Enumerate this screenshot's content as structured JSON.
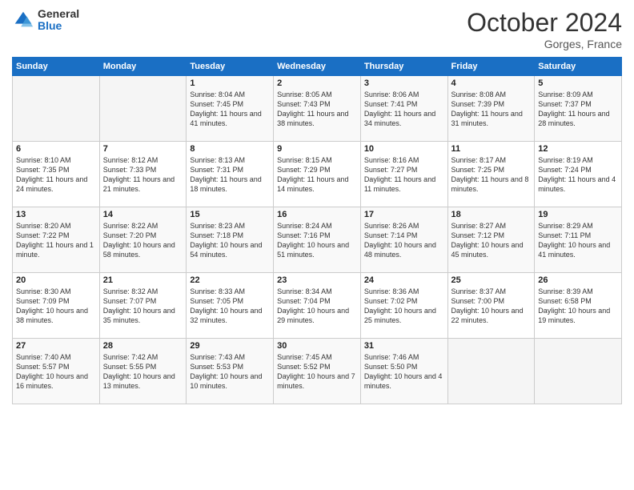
{
  "header": {
    "logo_general": "General",
    "logo_blue": "Blue",
    "month_title": "October 2024",
    "subtitle": "Gorges, France"
  },
  "days_of_week": [
    "Sunday",
    "Monday",
    "Tuesday",
    "Wednesday",
    "Thursday",
    "Friday",
    "Saturday"
  ],
  "weeks": [
    [
      {
        "day": "",
        "info": ""
      },
      {
        "day": "",
        "info": ""
      },
      {
        "day": "1",
        "info": "Sunrise: 8:04 AM\nSunset: 7:45 PM\nDaylight: 11 hours and 41 minutes."
      },
      {
        "day": "2",
        "info": "Sunrise: 8:05 AM\nSunset: 7:43 PM\nDaylight: 11 hours and 38 minutes."
      },
      {
        "day": "3",
        "info": "Sunrise: 8:06 AM\nSunset: 7:41 PM\nDaylight: 11 hours and 34 minutes."
      },
      {
        "day": "4",
        "info": "Sunrise: 8:08 AM\nSunset: 7:39 PM\nDaylight: 11 hours and 31 minutes."
      },
      {
        "day": "5",
        "info": "Sunrise: 8:09 AM\nSunset: 7:37 PM\nDaylight: 11 hours and 28 minutes."
      }
    ],
    [
      {
        "day": "6",
        "info": "Sunrise: 8:10 AM\nSunset: 7:35 PM\nDaylight: 11 hours and 24 minutes."
      },
      {
        "day": "7",
        "info": "Sunrise: 8:12 AM\nSunset: 7:33 PM\nDaylight: 11 hours and 21 minutes."
      },
      {
        "day": "8",
        "info": "Sunrise: 8:13 AM\nSunset: 7:31 PM\nDaylight: 11 hours and 18 minutes."
      },
      {
        "day": "9",
        "info": "Sunrise: 8:15 AM\nSunset: 7:29 PM\nDaylight: 11 hours and 14 minutes."
      },
      {
        "day": "10",
        "info": "Sunrise: 8:16 AM\nSunset: 7:27 PM\nDaylight: 11 hours and 11 minutes."
      },
      {
        "day": "11",
        "info": "Sunrise: 8:17 AM\nSunset: 7:25 PM\nDaylight: 11 hours and 8 minutes."
      },
      {
        "day": "12",
        "info": "Sunrise: 8:19 AM\nSunset: 7:24 PM\nDaylight: 11 hours and 4 minutes."
      }
    ],
    [
      {
        "day": "13",
        "info": "Sunrise: 8:20 AM\nSunset: 7:22 PM\nDaylight: 11 hours and 1 minute."
      },
      {
        "day": "14",
        "info": "Sunrise: 8:22 AM\nSunset: 7:20 PM\nDaylight: 10 hours and 58 minutes."
      },
      {
        "day": "15",
        "info": "Sunrise: 8:23 AM\nSunset: 7:18 PM\nDaylight: 10 hours and 54 minutes."
      },
      {
        "day": "16",
        "info": "Sunrise: 8:24 AM\nSunset: 7:16 PM\nDaylight: 10 hours and 51 minutes."
      },
      {
        "day": "17",
        "info": "Sunrise: 8:26 AM\nSunset: 7:14 PM\nDaylight: 10 hours and 48 minutes."
      },
      {
        "day": "18",
        "info": "Sunrise: 8:27 AM\nSunset: 7:12 PM\nDaylight: 10 hours and 45 minutes."
      },
      {
        "day": "19",
        "info": "Sunrise: 8:29 AM\nSunset: 7:11 PM\nDaylight: 10 hours and 41 minutes."
      }
    ],
    [
      {
        "day": "20",
        "info": "Sunrise: 8:30 AM\nSunset: 7:09 PM\nDaylight: 10 hours and 38 minutes."
      },
      {
        "day": "21",
        "info": "Sunrise: 8:32 AM\nSunset: 7:07 PM\nDaylight: 10 hours and 35 minutes."
      },
      {
        "day": "22",
        "info": "Sunrise: 8:33 AM\nSunset: 7:05 PM\nDaylight: 10 hours and 32 minutes."
      },
      {
        "day": "23",
        "info": "Sunrise: 8:34 AM\nSunset: 7:04 PM\nDaylight: 10 hours and 29 minutes."
      },
      {
        "day": "24",
        "info": "Sunrise: 8:36 AM\nSunset: 7:02 PM\nDaylight: 10 hours and 25 minutes."
      },
      {
        "day": "25",
        "info": "Sunrise: 8:37 AM\nSunset: 7:00 PM\nDaylight: 10 hours and 22 minutes."
      },
      {
        "day": "26",
        "info": "Sunrise: 8:39 AM\nSunset: 6:58 PM\nDaylight: 10 hours and 19 minutes."
      }
    ],
    [
      {
        "day": "27",
        "info": "Sunrise: 7:40 AM\nSunset: 5:57 PM\nDaylight: 10 hours and 16 minutes."
      },
      {
        "day": "28",
        "info": "Sunrise: 7:42 AM\nSunset: 5:55 PM\nDaylight: 10 hours and 13 minutes."
      },
      {
        "day": "29",
        "info": "Sunrise: 7:43 AM\nSunset: 5:53 PM\nDaylight: 10 hours and 10 minutes."
      },
      {
        "day": "30",
        "info": "Sunrise: 7:45 AM\nSunset: 5:52 PM\nDaylight: 10 hours and 7 minutes."
      },
      {
        "day": "31",
        "info": "Sunrise: 7:46 AM\nSunset: 5:50 PM\nDaylight: 10 hours and 4 minutes."
      },
      {
        "day": "",
        "info": ""
      },
      {
        "day": "",
        "info": ""
      }
    ]
  ]
}
